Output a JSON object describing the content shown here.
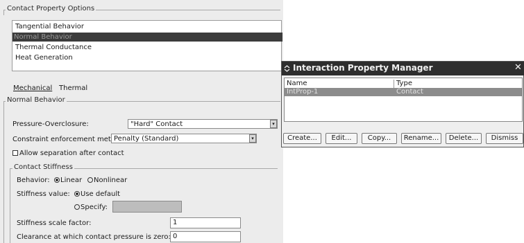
{
  "editor": {
    "contact_options": {
      "title": "Contact Property Options",
      "items": [
        "Tangential Behavior",
        "Normal Behavior",
        "Thermal Conductance",
        "Heat Generation"
      ],
      "selected": "Normal Behavior"
    },
    "menu": {
      "mechanical": "Mechanical",
      "thermal": "Thermal"
    },
    "normal_behavior": {
      "title": "Normal Behavior",
      "pressure_label": "Pressure-Overclosure:",
      "pressure_value": "\"Hard\" Contact",
      "constraint_label": "Constraint enforcement method:",
      "constraint_value": "Penalty (Standard)",
      "allow_separation_label": "Allow separation after contact"
    },
    "contact_stiffness": {
      "title": "Contact Stiffness",
      "behavior_label": "Behavior:",
      "linear": "Linear",
      "nonlinear": "Nonlinear",
      "stiffness_label": "Stiffness value:",
      "use_default": "Use default",
      "specify": "Specify:",
      "scale_label": "Stiffness scale factor:",
      "scale_value": "1",
      "clearance_label": "Clearance at which contact pressure is zero:",
      "clearance_value": "0"
    }
  },
  "manager": {
    "title": "Interaction Property Manager",
    "columns": [
      "Name",
      "Type"
    ],
    "rows": [
      {
        "name": "IntProp-1",
        "type": "Contact"
      }
    ],
    "buttons": {
      "create": "Create...",
      "edit": "Edit...",
      "copy": "Copy...",
      "rename": "Rename...",
      "delete": "Delete...",
      "dismiss": "Dismiss"
    }
  },
  "colors": {
    "selection": "#3c3c3c",
    "title_bar": "#2e2e2e",
    "panel": "#ececec"
  },
  "icons": {
    "close": "close-icon",
    "dropdown": "dropdown-arrow-icon",
    "restore": "restore-icon"
  }
}
